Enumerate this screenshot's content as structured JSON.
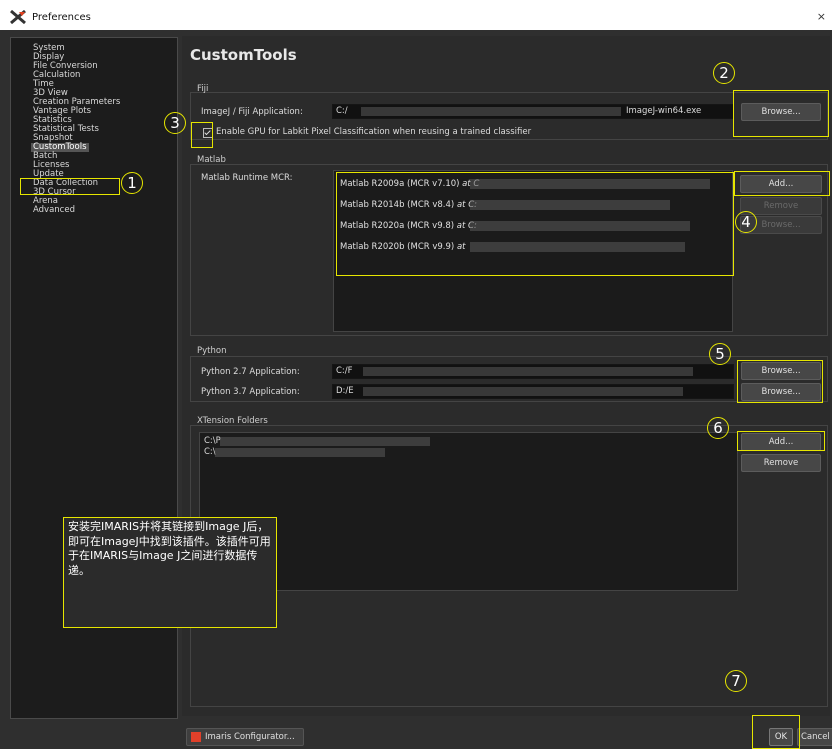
{
  "window": {
    "title": "Preferences",
    "close": "×",
    "app_icon": "imaris-x-icon"
  },
  "sidebar": {
    "items": [
      "System",
      "Display",
      "File Conversion",
      "Calculation",
      "Time",
      "3D View",
      "Creation Parameters",
      "Vantage Plots",
      "Statistics",
      "Statistical Tests",
      "Snapshot",
      "CustomTools",
      "Batch",
      "Licenses",
      "Update",
      "Data Collection",
      "3D Cursor",
      "Arena",
      "Advanced"
    ],
    "selected": "CustomTools"
  },
  "page_title": "CustomTools",
  "fiji": {
    "group_label": "Fiji",
    "app_label": "ImageJ / Fiji Application:",
    "path_start": "C:/",
    "path_end": "ImageJ-win64.exe",
    "browse_label": "Browse...",
    "gpu_checkbox_label": "Enable GPU for Labkit Pixel Classification when reusing a trained classifier",
    "gpu_checked": true
  },
  "matlab": {
    "group_label": "Matlab",
    "mcr_label": "Matlab Runtime MCR:",
    "entries": [
      {
        "name": "Matlab R2009a (MCR v7.10)",
        "at": "at C"
      },
      {
        "name": "Matlab R2014b (MCR v8.4)",
        "at": "at C:"
      },
      {
        "name": "Matlab R2020a (MCR v9.8)",
        "at": "at C:"
      },
      {
        "name": "Matlab R2020b (MCR v9.9)",
        "at": "at"
      }
    ],
    "add_label": "Add...",
    "remove_label": "Remove",
    "browse_label": "Browse..."
  },
  "python": {
    "group_label": "Python",
    "py27_label": "Python 2.7 Application:",
    "py27_value": "C:/F",
    "py37_label": "Python 3.7 Application:",
    "py37_value": "D:/E",
    "browse_label": "Browse..."
  },
  "xtension": {
    "group_label": "XTension Folders",
    "folders": [
      "C:\\P",
      "C:\\"
    ],
    "add_label": "Add...",
    "remove_label": "Remove"
  },
  "annotations": {
    "numbers": [
      "1",
      "2",
      "3",
      "4",
      "5",
      "6",
      "7"
    ],
    "note_text": "安装完IMARIS并将其链接到Image J后，即可在ImageJ中找到该插件。该插件可用于在IMARIS与Image J之间进行数据传递。",
    "highlight_color": "#e6e600"
  },
  "footer": {
    "configurator_label": "Imaris Configurator...",
    "ok_label": "OK",
    "cancel_label": "Cancel"
  }
}
